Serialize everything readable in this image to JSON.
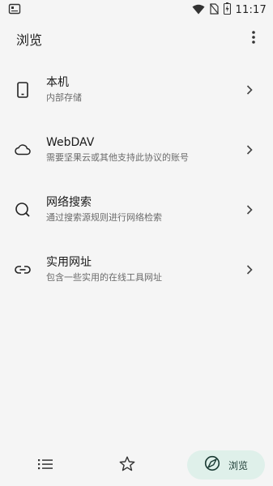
{
  "status_bar": {
    "time": "11:17"
  },
  "app_bar": {
    "title": "浏览"
  },
  "items": [
    {
      "title": "本机",
      "subtitle": "内部存储",
      "icon": "phone-icon"
    },
    {
      "title": "WebDAV",
      "subtitle": "需要坚果云或其他支持此协议的账号",
      "icon": "cloud-icon"
    },
    {
      "title": "网络搜索",
      "subtitle": "通过搜索源规则进行网络检索",
      "icon": "search-icon"
    },
    {
      "title": "实用网址",
      "subtitle": "包含一些实用的在线工具网址",
      "icon": "link-icon"
    }
  ],
  "bottom_nav": {
    "active_label": "浏览",
    "active_color": "#dff0ea"
  }
}
